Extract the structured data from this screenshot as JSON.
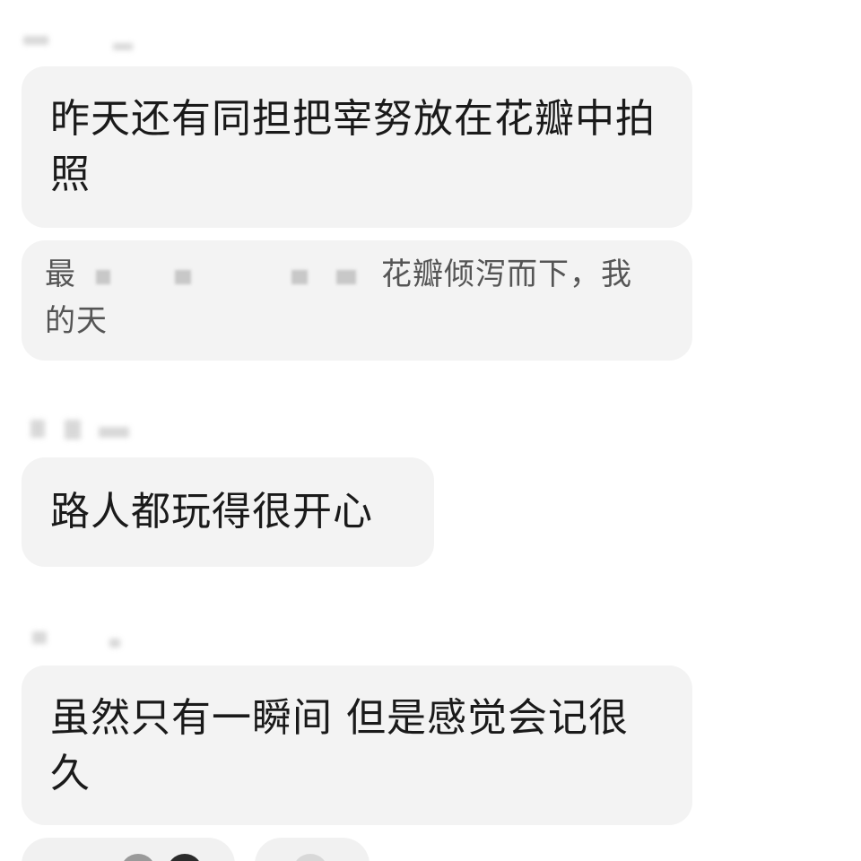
{
  "comments": [
    {
      "text": "昨天还有同担把宰努放在花瓣中拍照",
      "quote": {
        "prefix": "最",
        "suffix": "花瓣倾泻而下，我的天"
      }
    },
    {
      "text": "路人都玩得很开心"
    },
    {
      "text": "虽然只有一瞬间 但是感觉会记很久"
    }
  ],
  "colors": {
    "bubble": "#f3f3f3",
    "text": "#1a1a1a",
    "quote_text": "#555555",
    "background": "#ffffff"
  }
}
